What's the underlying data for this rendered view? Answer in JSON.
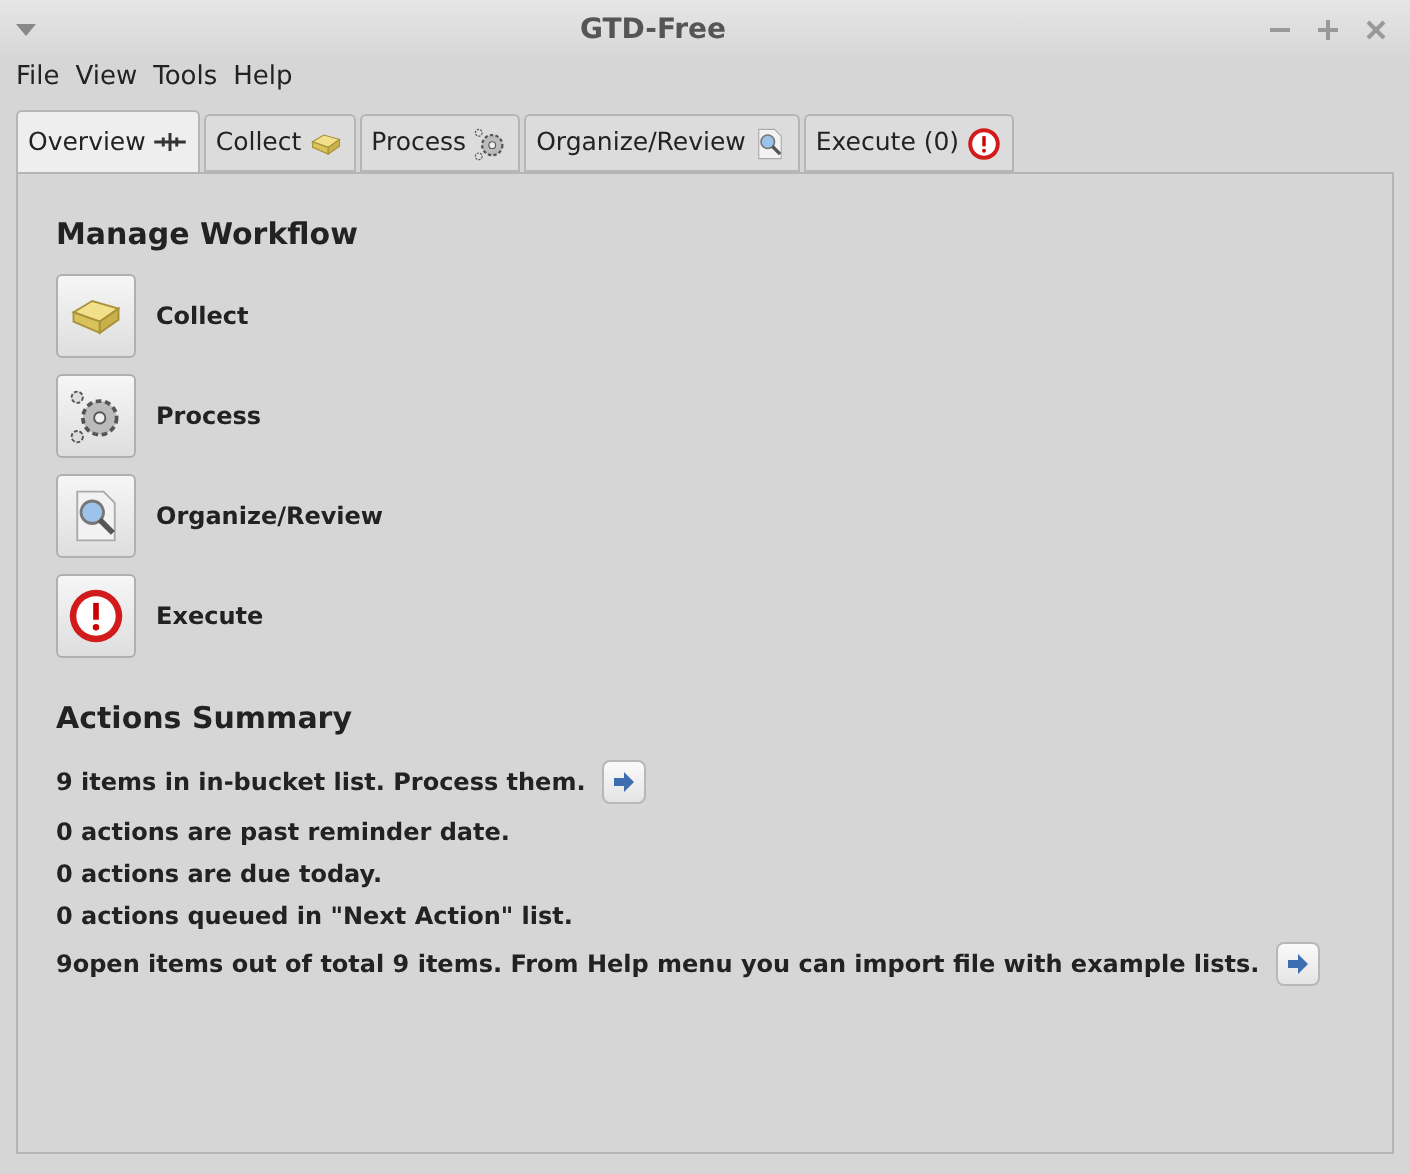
{
  "window": {
    "title": "GTD-Free"
  },
  "menu": [
    "File",
    "View",
    "Tools",
    "Help"
  ],
  "tabs": [
    {
      "label": "Overview",
      "selected": true,
      "kind": "overview"
    },
    {
      "label": "Collect",
      "selected": false,
      "kind": "collect"
    },
    {
      "label": "Process",
      "selected": false,
      "kind": "process"
    },
    {
      "label": "Organize/Review",
      "selected": false,
      "kind": "organize"
    },
    {
      "label": "Execute (0)",
      "selected": false,
      "kind": "execute"
    }
  ],
  "workflow": {
    "title": "Manage Workflow",
    "items": [
      {
        "label": "Collect",
        "kind": "collect"
      },
      {
        "label": "Process",
        "kind": "process"
      },
      {
        "label": "Organize/Review",
        "kind": "organize"
      },
      {
        "label": "Execute",
        "kind": "execute"
      }
    ]
  },
  "summary": {
    "title": "Actions Summary",
    "lines": [
      {
        "text": "9 items in in-bucket list. Process them.",
        "kind": "action"
      },
      {
        "text": "0 actions are past reminder date.",
        "kind": "plain"
      },
      {
        "text": "0 actions are due today.",
        "kind": "plain"
      },
      {
        "text": "0 actions queued in \"Next Action\" list.",
        "kind": "plain"
      },
      {
        "text": "9open items out of total 9 items. From Help menu you can import file with example lists.",
        "kind": "action"
      }
    ]
  }
}
